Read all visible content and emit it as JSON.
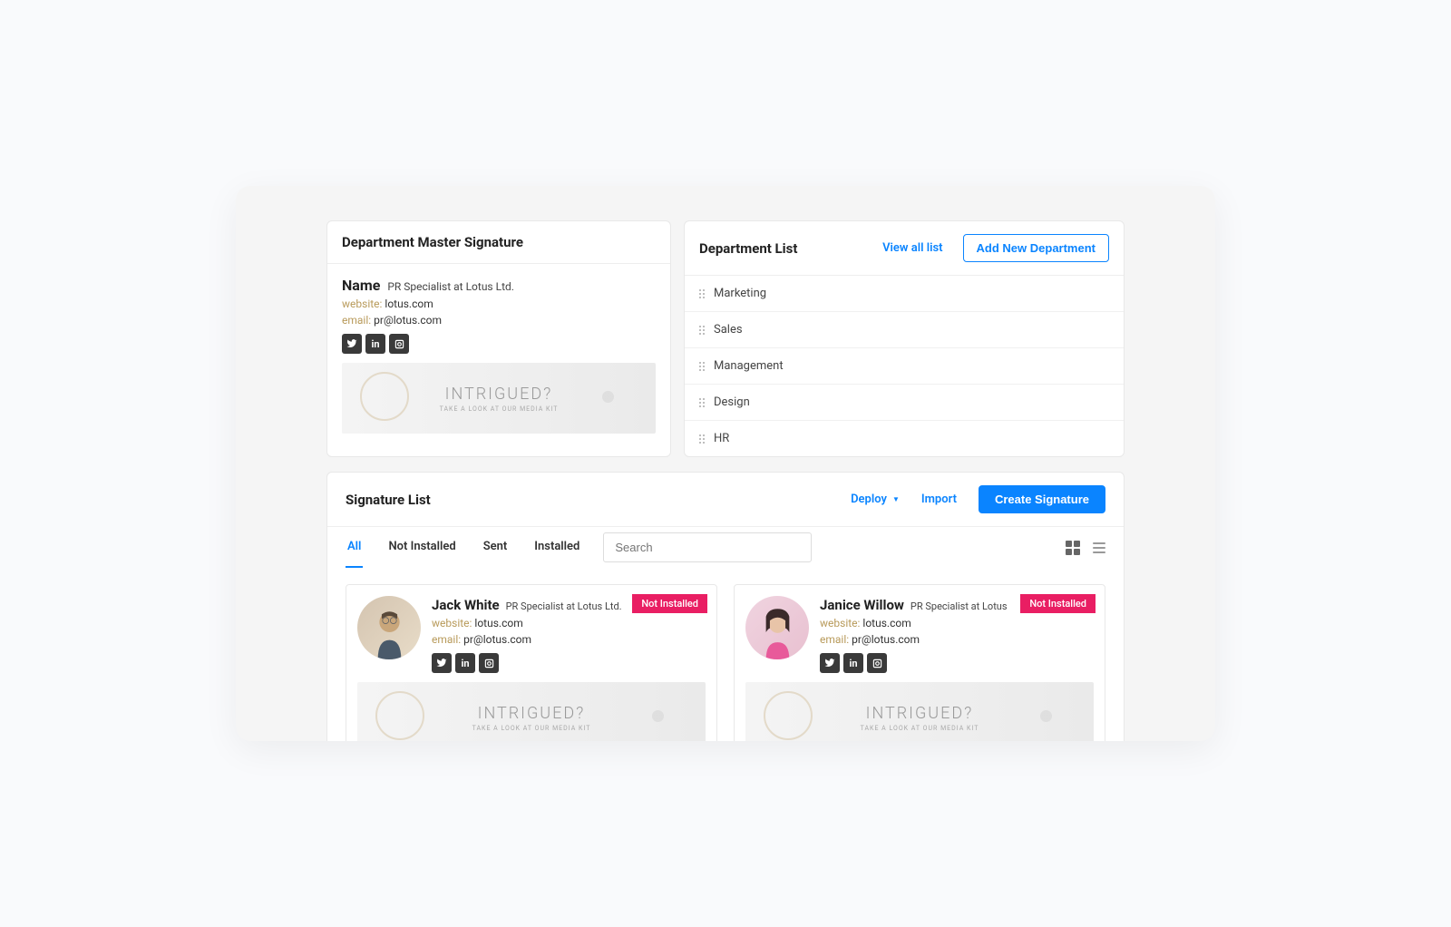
{
  "master": {
    "title": "Department Master Signature",
    "name": "Name",
    "role": "PR Specialist at Lotus Ltd.",
    "website_label": "website:",
    "website_value": "lotus.com",
    "email_label": "email:",
    "email_value": "pr@lotus.com",
    "banner_title": "INTRIGUED?",
    "banner_sub": "TAKE A LOOK AT OUR MEDIA KIT"
  },
  "dept": {
    "title": "Department List",
    "view_all": "View all list",
    "add_new": "Add New Department",
    "items": [
      "Marketing",
      "Sales",
      "Management",
      "Design",
      "HR"
    ]
  },
  "siglist": {
    "title": "Signature List",
    "deploy": "Deploy",
    "import": "Import",
    "create": "Create Signature",
    "search_placeholder": "Search",
    "tabs": [
      "All",
      "Not Installed",
      "Sent",
      "Installed"
    ],
    "cards": [
      {
        "name": "Jack White",
        "role": "PR Specialist at Lotus Ltd.",
        "website_label": "website:",
        "website_value": "lotus.com",
        "email_label": "email:",
        "email_value": "pr@lotus.com",
        "status": "Not Installed",
        "banner_title": "INTRIGUED?",
        "banner_sub": "TAKE A LOOK AT OUR MEDIA KIT"
      },
      {
        "name": "Janice Willow",
        "role": "PR Specialist at Lotus",
        "website_label": "website:",
        "website_value": "lotus.com",
        "email_label": "email:",
        "email_value": "pr@lotus.com",
        "status": "Not Installed",
        "banner_title": "INTRIGUED?",
        "banner_sub": "TAKE A LOOK AT OUR MEDIA KIT"
      }
    ]
  }
}
